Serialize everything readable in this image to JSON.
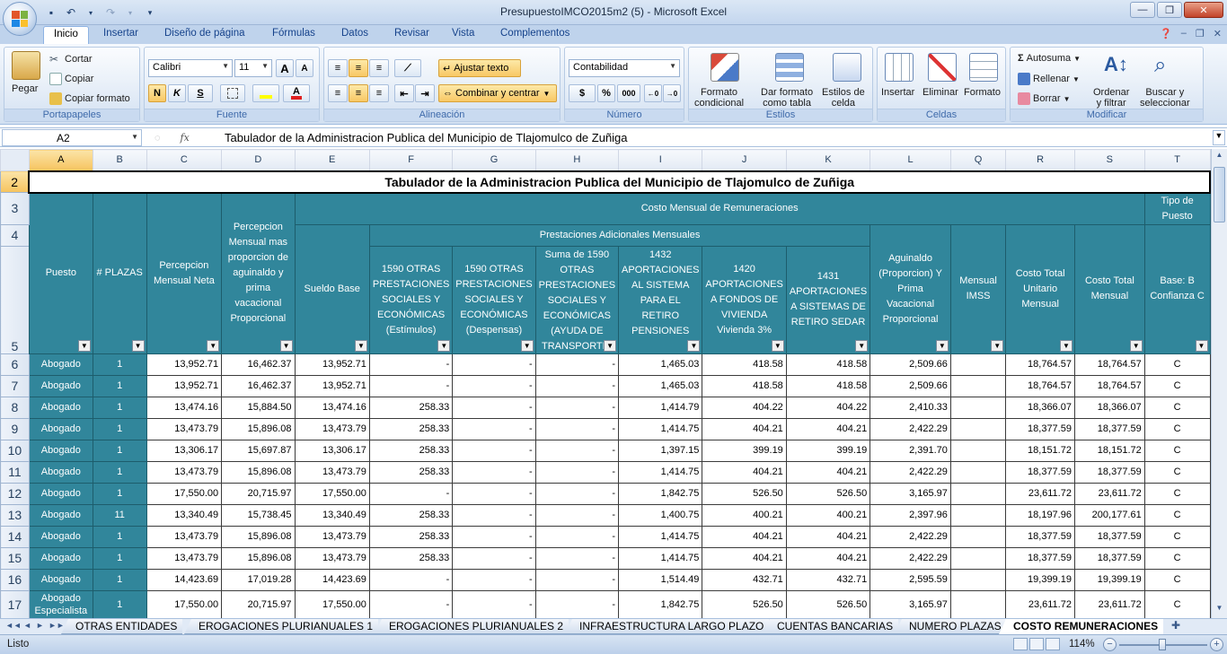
{
  "window": {
    "title": "PresupuestoIMCO2015m2 (5) - Microsoft Excel"
  },
  "menu_tabs": [
    "Inicio",
    "Insertar",
    "Diseño de página",
    "Fórmulas",
    "Datos",
    "Revisar",
    "Vista",
    "Complementos"
  ],
  "ribbon": {
    "portapapeles": {
      "paste": "Pegar",
      "cut": "Cortar",
      "copy": "Copiar",
      "format_painter": "Copiar formato",
      "label": "Portapapeles"
    },
    "fuente": {
      "font": "Calibri",
      "size": "11",
      "grow": "A",
      "shrink": "A",
      "bold": "N",
      "italic": "K",
      "underline": "S",
      "label": "Fuente"
    },
    "alineacion": {
      "wrap": "Ajustar texto",
      "merge": "Combinar y centrar",
      "label": "Alineación"
    },
    "numero": {
      "format": "Contabilidad",
      "currency": "$",
      "percent": "%",
      "thousands": "000",
      "label": "Número"
    },
    "estilos": {
      "cond_format_1": "Formato",
      "cond_format_2": "condicional",
      "table_format_1": "Dar formato",
      "table_format_2": "como tabla",
      "cell_styles_1": "Estilos de",
      "cell_styles_2": "celda",
      "label": "Estilos"
    },
    "celdas": {
      "insert": "Insertar",
      "delete": "Eliminar",
      "format": "Formato",
      "label": "Celdas"
    },
    "modificar": {
      "autosum": "Autosuma",
      "fill": "Rellenar",
      "clear": "Borrar",
      "sort_1": "Ordenar",
      "sort_2": "y filtrar",
      "find_1": "Buscar y",
      "find_2": "seleccionar",
      "label": "Modificar"
    }
  },
  "formula_bar": {
    "name_box": "A2",
    "fx": "fx",
    "content": "Tabulador de la Administracion Publica del Municipio de Tlajomulco de Zuñiga"
  },
  "columns": [
    "A",
    "B",
    "C",
    "D",
    "E",
    "F",
    "G",
    "H",
    "I",
    "J",
    "K",
    "L",
    "Q",
    "R",
    "S",
    "T"
  ],
  "row_numbers": [
    "2",
    "3",
    "4",
    "5",
    "6",
    "7",
    "8",
    "9",
    "10",
    "11",
    "12",
    "13",
    "14",
    "15",
    "16",
    "17"
  ],
  "sheet": {
    "title": "Tabulador de la Administracion Publica del Municipio de Tlajomulco de Zuñiga",
    "group_costo": "Costo Mensual de Remuneraciones",
    "group_prestaciones": "Prestaciones Adicionales Mensuales",
    "tipo_puesto": "Tipo de Puesto",
    "headers": {
      "A": "Puesto",
      "B": "# PLAZAS",
      "C": "Percepcion Mensual Neta",
      "D": "Percepcion Mensual mas proporcion de aguinaldo y prima vacacional Proporcional",
      "E": "Sueldo Base",
      "F": "1590 OTRAS PRESTACIONES SOCIALES Y ECONÓMICAS (Estímulos)",
      "G": "1590 OTRAS PRESTACIONES SOCIALES Y ECONÓMICAS (Despensas)",
      "H": "Suma de 1590 OTRAS PRESTACIONES SOCIALES Y ECONÓMICAS (AYUDA DE TRANSPORTE)",
      "I": "1432 APORTACIONES AL SISTEMA PARA EL RETIRO PENSIONES",
      "J": "1420 APORTACIONES A FONDOS DE VIVIENDA Vivienda 3%",
      "K": "1431 APORTACIONES A SISTEMAS DE RETIRO SEDAR",
      "L": "Aguinaldo (Proporcion) Y Prima Vacacional Proporcional",
      "Q": "Mensual IMSS",
      "R": "Costo Total Unitario Mensual",
      "S": "Costo Total Mensual",
      "T": "Base: B Confianza C"
    },
    "rows": [
      {
        "n": "6",
        "puesto": "Abogado",
        "plazas": "1",
        "c": "13,952.71",
        "d": "16,462.37",
        "e": "13,952.71",
        "f": "-",
        "g": "-",
        "h": "-",
        "i": "1,465.03",
        "j": "418.58",
        "k": "418.58",
        "l": "2,509.66",
        "q": "",
        "r": "18,764.57",
        "s": "18,764.57",
        "t": "C"
      },
      {
        "n": "7",
        "puesto": "Abogado",
        "plazas": "1",
        "c": "13,952.71",
        "d": "16,462.37",
        "e": "13,952.71",
        "f": "-",
        "g": "-",
        "h": "-",
        "i": "1,465.03",
        "j": "418.58",
        "k": "418.58",
        "l": "2,509.66",
        "q": "",
        "r": "18,764.57",
        "s": "18,764.57",
        "t": "C"
      },
      {
        "n": "8",
        "puesto": "Abogado",
        "plazas": "1",
        "c": "13,474.16",
        "d": "15,884.50",
        "e": "13,474.16",
        "f": "258.33",
        "g": "-",
        "h": "-",
        "i": "1,414.79",
        "j": "404.22",
        "k": "404.22",
        "l": "2,410.33",
        "q": "",
        "r": "18,366.07",
        "s": "18,366.07",
        "t": "C"
      },
      {
        "n": "9",
        "puesto": "Abogado",
        "plazas": "1",
        "c": "13,473.79",
        "d": "15,896.08",
        "e": "13,473.79",
        "f": "258.33",
        "g": "-",
        "h": "-",
        "i": "1,414.75",
        "j": "404.21",
        "k": "404.21",
        "l": "2,422.29",
        "q": "",
        "r": "18,377.59",
        "s": "18,377.59",
        "t": "C"
      },
      {
        "n": "10",
        "puesto": "Abogado",
        "plazas": "1",
        "c": "13,306.17",
        "d": "15,697.87",
        "e": "13,306.17",
        "f": "258.33",
        "g": "-",
        "h": "-",
        "i": "1,397.15",
        "j": "399.19",
        "k": "399.19",
        "l": "2,391.70",
        "q": "",
        "r": "18,151.72",
        "s": "18,151.72",
        "t": "C"
      },
      {
        "n": "11",
        "puesto": "Abogado",
        "plazas": "1",
        "c": "13,473.79",
        "d": "15,896.08",
        "e": "13,473.79",
        "f": "258.33",
        "g": "-",
        "h": "-",
        "i": "1,414.75",
        "j": "404.21",
        "k": "404.21",
        "l": "2,422.29",
        "q": "",
        "r": "18,377.59",
        "s": "18,377.59",
        "t": "C"
      },
      {
        "n": "12",
        "puesto": "Abogado",
        "plazas": "1",
        "c": "17,550.00",
        "d": "20,715.97",
        "e": "17,550.00",
        "f": "-",
        "g": "-",
        "h": "-",
        "i": "1,842.75",
        "j": "526.50",
        "k": "526.50",
        "l": "3,165.97",
        "q": "",
        "r": "23,611.72",
        "s": "23,611.72",
        "t": "C"
      },
      {
        "n": "13",
        "puesto": "Abogado",
        "plazas": "11",
        "c": "13,340.49",
        "d": "15,738.45",
        "e": "13,340.49",
        "f": "258.33",
        "g": "-",
        "h": "-",
        "i": "1,400.75",
        "j": "400.21",
        "k": "400.21",
        "l": "2,397.96",
        "q": "",
        "r": "18,197.96",
        "s": "200,177.61",
        "t": "C"
      },
      {
        "n": "14",
        "puesto": "Abogado",
        "plazas": "1",
        "c": "13,473.79",
        "d": "15,896.08",
        "e": "13,473.79",
        "f": "258.33",
        "g": "-",
        "h": "-",
        "i": "1,414.75",
        "j": "404.21",
        "k": "404.21",
        "l": "2,422.29",
        "q": "",
        "r": "18,377.59",
        "s": "18,377.59",
        "t": "C"
      },
      {
        "n": "15",
        "puesto": "Abogado",
        "plazas": "1",
        "c": "13,473.79",
        "d": "15,896.08",
        "e": "13,473.79",
        "f": "258.33",
        "g": "-",
        "h": "-",
        "i": "1,414.75",
        "j": "404.21",
        "k": "404.21",
        "l": "2,422.29",
        "q": "",
        "r": "18,377.59",
        "s": "18,377.59",
        "t": "C"
      },
      {
        "n": "16",
        "puesto": "Abogado",
        "plazas": "1",
        "c": "14,423.69",
        "d": "17,019.28",
        "e": "14,423.69",
        "f": "-",
        "g": "-",
        "h": "-",
        "i": "1,514.49",
        "j": "432.71",
        "k": "432.71",
        "l": "2,595.59",
        "q": "",
        "r": "19,399.19",
        "s": "19,399.19",
        "t": "C"
      },
      {
        "n": "17",
        "puesto": "Abogado Especialista",
        "plazas": "1",
        "c": "17,550.00",
        "d": "20,715.97",
        "e": "17,550.00",
        "f": "-",
        "g": "-",
        "h": "-",
        "i": "1,842.75",
        "j": "526.50",
        "k": "526.50",
        "l": "3,165.97",
        "q": "",
        "r": "23,611.72",
        "s": "23,611.72",
        "t": "C"
      }
    ]
  },
  "sheet_tabs": [
    "OTRAS ENTIDADES",
    "EROGACIONES PLURIANUALES 1",
    "EROGACIONES PLURIANUALES 2",
    "INFRAESTRUCTURA LARGO PLAZO",
    "CUENTAS BANCARIAS",
    "NUMERO PLAZAS",
    "COSTO REMUNERACIONES"
  ],
  "status": {
    "text": "Listo",
    "zoom": "114%"
  },
  "colors": {
    "header_fill": "#31869b",
    "selection": "#f6c35e"
  }
}
